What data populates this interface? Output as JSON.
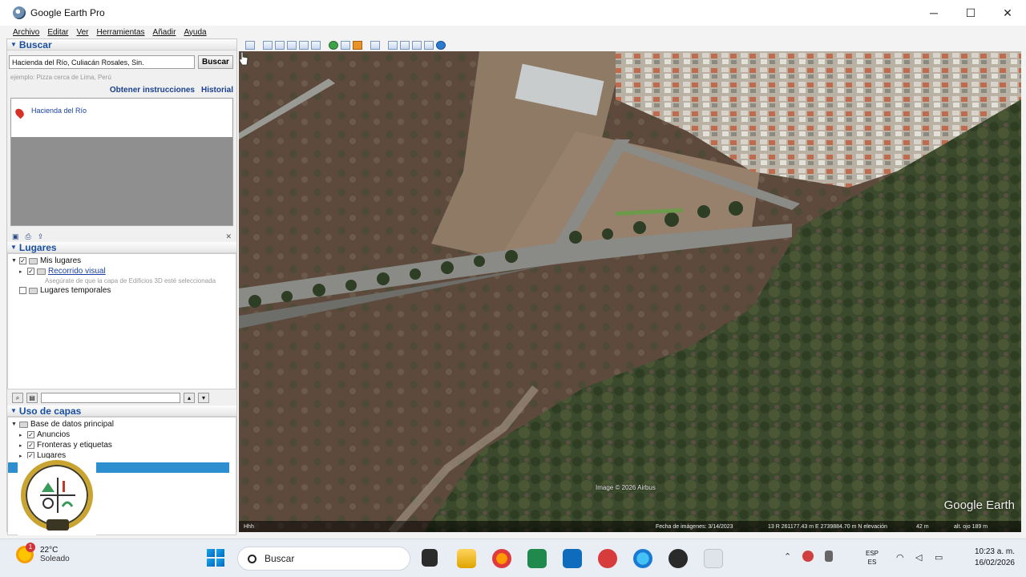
{
  "window": {
    "title": "Google Earth Pro",
    "controls": [
      "─",
      "☐",
      "✕"
    ]
  },
  "menu": [
    "Archivo",
    "Editar",
    "Ver",
    "Herramientas",
    "Añadir",
    "Ayuda"
  ],
  "search": {
    "header": "Buscar",
    "query": "Hacienda del Río, Culiacán Rosales, Sin.",
    "button": "Buscar",
    "example": "ejemplo: Pizza cerca de Lima, Perú",
    "directions_link": "Obtener instrucciones",
    "history_link": "Historial",
    "result": "Hacienda del Río"
  },
  "places": {
    "header": "Lugares",
    "my_places": "Mis lugares",
    "tour": "Recorrido visual",
    "tour_note": "Asegúrate de que la capa de Edificios 3D esté seleccionada",
    "temp_places": "Lugares temporales"
  },
  "layers": {
    "header": "Uso de capas",
    "primary_db": "Base de datos principal",
    "items": [
      "Anuncios",
      "Fronteras y etiquetas",
      "Lugares"
    ]
  },
  "map": {
    "attribution": "Image © 2026 Airbus",
    "brand": "Google Earth",
    "status_left": "Hhh",
    "imagery_date": "Fecha de imágenes: 3/14/2023",
    "coordinates": "13 R 261177.43 m E 2739884.70 m N",
    "elevation_label": "elevación",
    "elevation": "42 m",
    "eye_label": "alt. ojo",
    "eye": "189 m"
  },
  "taskbar": {
    "weather_badge": "1",
    "temperature": "22°C",
    "condition": "Soleado",
    "search_placeholder": "Buscar",
    "lang_top": "ESP",
    "lang_bottom": "ES",
    "time": "10:23 a. m.",
    "date": "16/02/2026"
  }
}
